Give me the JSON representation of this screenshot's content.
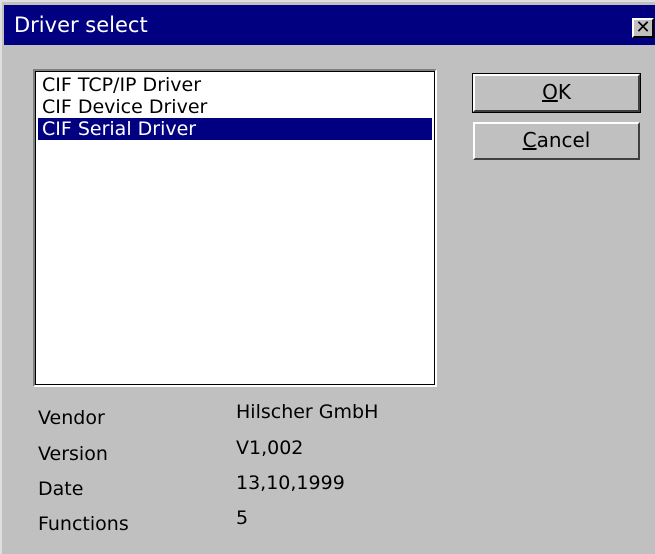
{
  "window": {
    "title": "Driver select",
    "close_glyph": "✕"
  },
  "drivers": {
    "items": [
      {
        "label": "CIF TCP/IP Driver",
        "selected": false
      },
      {
        "label": "CIF Device Driver",
        "selected": false
      },
      {
        "label": "CIF Serial Driver",
        "selected": true
      }
    ]
  },
  "buttons": {
    "ok": {
      "label": "OK",
      "accelerator": "O"
    },
    "cancel": {
      "label": "Cancel",
      "accelerator": "C"
    }
  },
  "info": {
    "vendor_label": "Vendor",
    "vendor_value": "Hilscher GmbH",
    "version_label": "Version",
    "version_value": "V1,002",
    "date_label": "Date",
    "date_value": "13,10,1999",
    "functions_label": "Functions",
    "functions_value": "5"
  },
  "colors": {
    "titlebar": "#000080",
    "face": "#c0c0c0",
    "selection": "#000080"
  },
  "icons": {
    "close": "close-icon"
  }
}
